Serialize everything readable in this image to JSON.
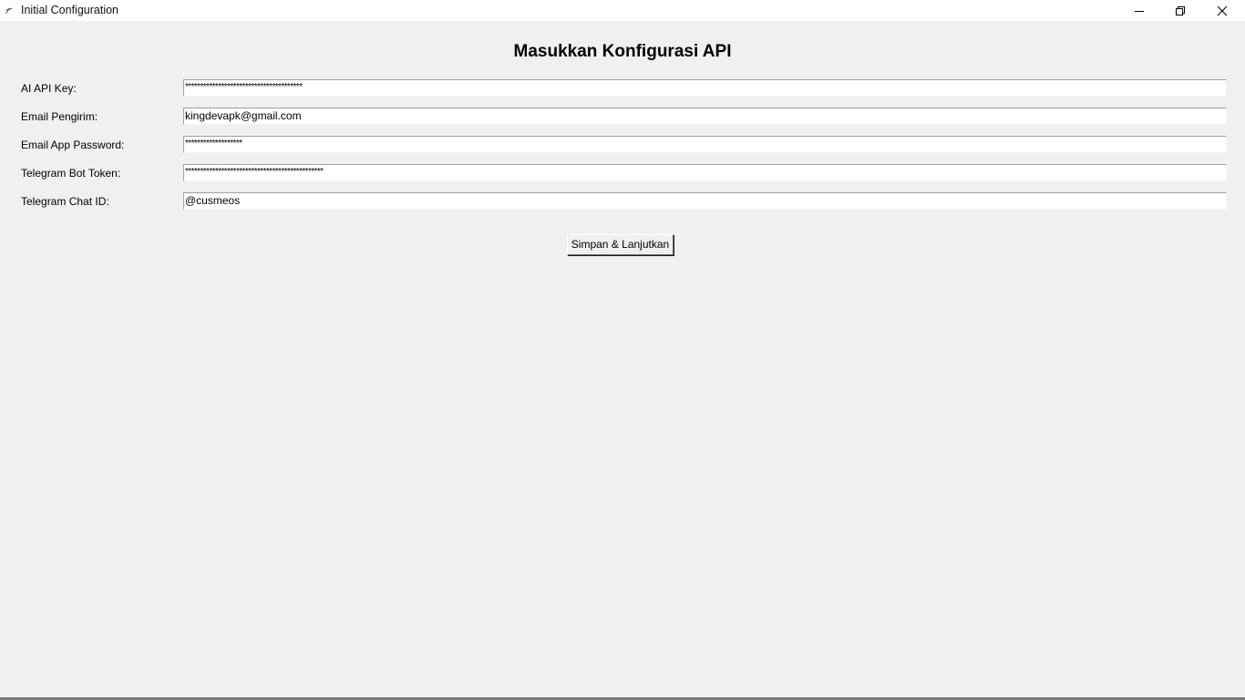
{
  "window": {
    "title": "Initial Configuration",
    "icon": "feather-icon",
    "controls": [
      "minimize-icon",
      "restore-icon",
      "close-icon"
    ]
  },
  "form": {
    "heading": "Masukkan Konfigurasi API",
    "fields": [
      {
        "label": "AI API Key:",
        "value": "***************************************"
      },
      {
        "label": "Email Pengirim:",
        "value": "kingdevapk@gmail.com"
      },
      {
        "label": "Email App Password:",
        "value": "*******************"
      },
      {
        "label": "Telegram Bot Token:",
        "value": "**********************************************"
      },
      {
        "label": "Telegram Chat ID:",
        "value": "@cusmeos"
      }
    ],
    "submit_label": "Simpan & Lanjutkan"
  },
  "colors": {
    "background": "#f0f0f0",
    "titlebar": "#ffffff",
    "field_background": "#ffffff"
  }
}
